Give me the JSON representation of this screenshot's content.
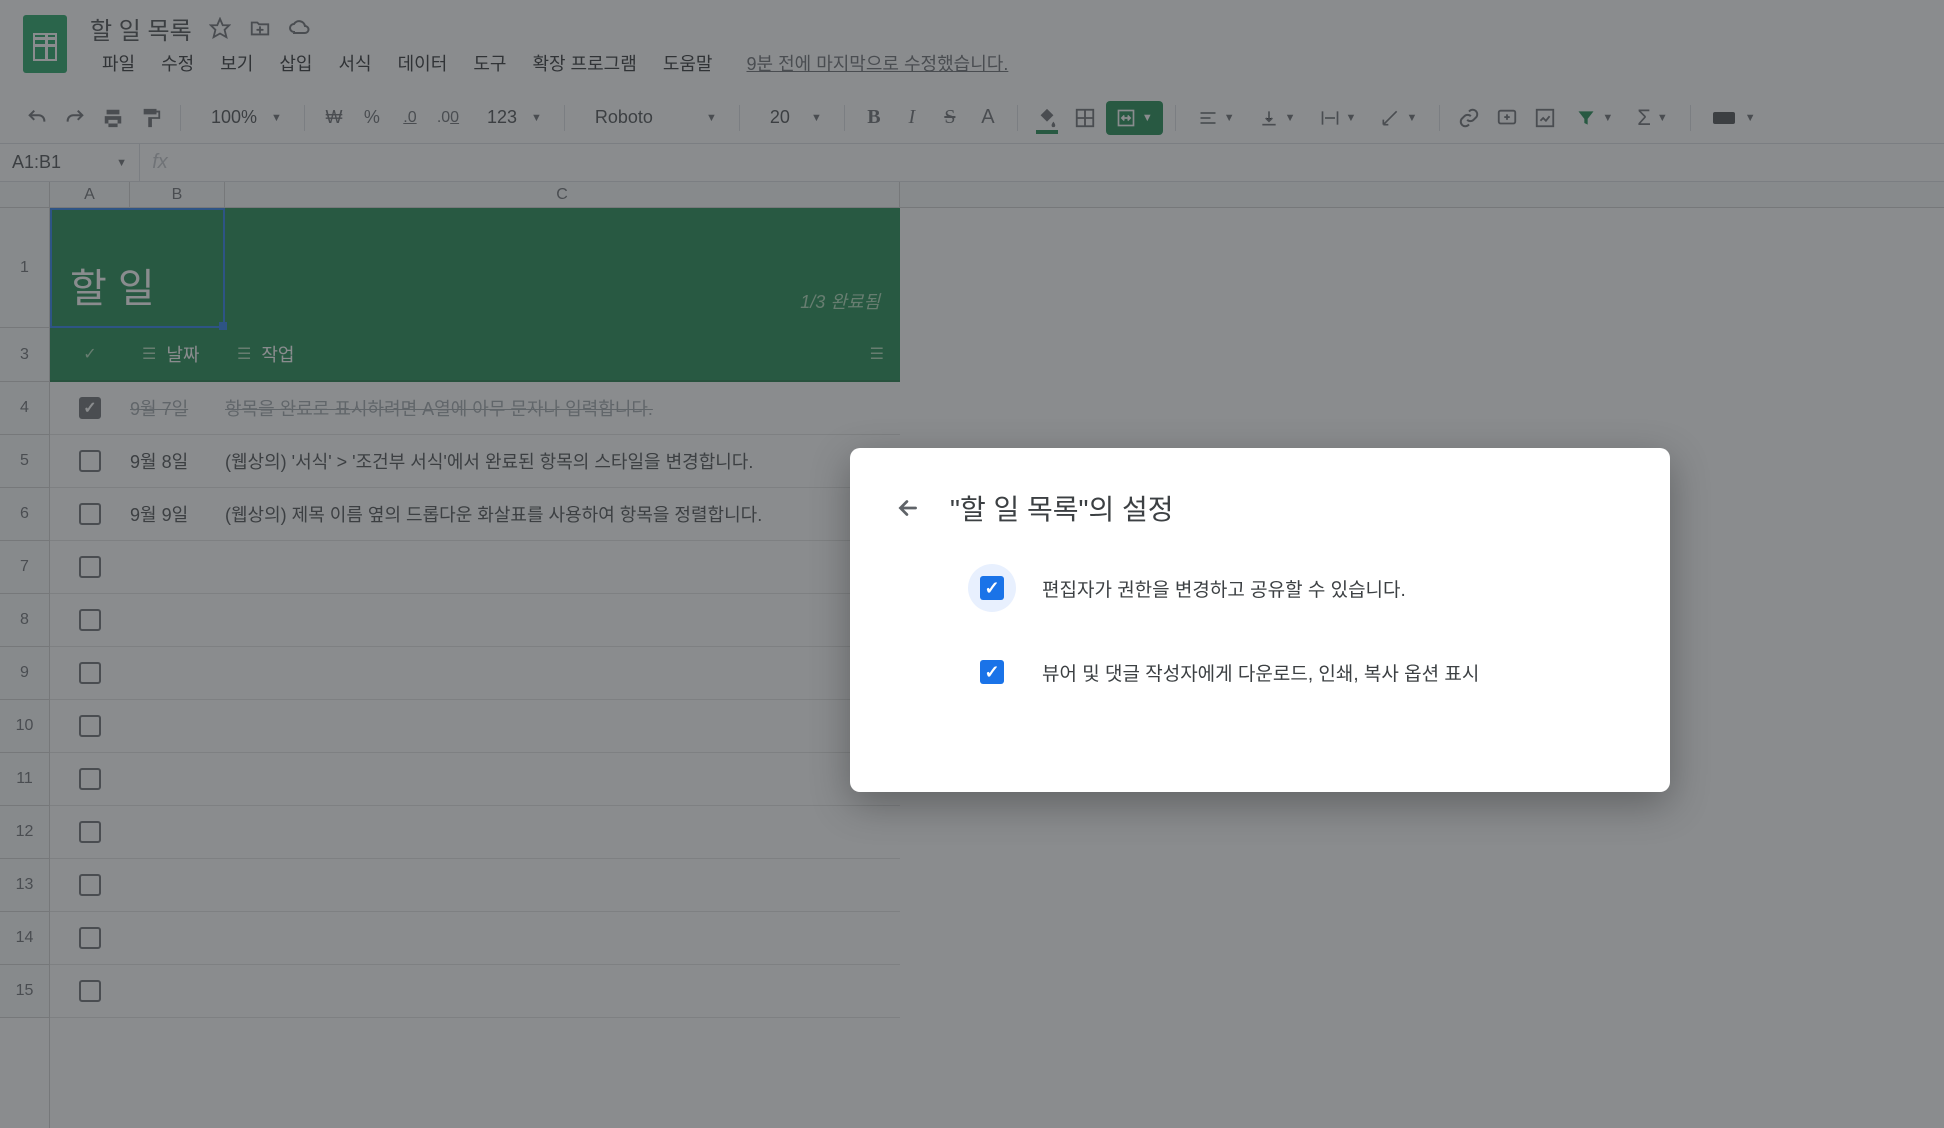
{
  "header": {
    "doc_title": "할 일 목록",
    "menus": [
      "파일",
      "수정",
      "보기",
      "삽입",
      "서식",
      "데이터",
      "도구",
      "확장 프로그램",
      "도움말"
    ],
    "last_edit": "9분 전에 마지막으로 수정했습니다."
  },
  "toolbar": {
    "zoom": "100%",
    "currency": "₩",
    "percent": "%",
    "dec_dec": ".0",
    "dec_inc": ".00",
    "numfmt": "123",
    "font": "Roboto",
    "size": "20"
  },
  "namebox": {
    "ref": "A1:B1",
    "fx": "fx"
  },
  "columns": [
    "A",
    "B",
    "C"
  ],
  "banner": {
    "title": "할 일",
    "sub": "1/3 완료됨"
  },
  "headers": {
    "date": "날짜",
    "task": "작업"
  },
  "rows": [
    {
      "checked": true,
      "date": "9월 7일",
      "task": "항목을 완료로 표시하려면 A열에 아무 문자나 입력합니다."
    },
    {
      "checked": false,
      "date": "9월 8일",
      "task": "(웹상의) '서식' > '조건부 서식'에서 완료된 항목의 스타일을 변경합니다."
    },
    {
      "checked": false,
      "date": "9월 9일",
      "task": "(웹상의) 제목 이름 옆의 드롭다운 화살표를 사용하여 항목을 정렬합니다."
    }
  ],
  "dialog": {
    "title": "\"할 일 목록\"의 설정",
    "opt1": "편집자가 권한을 변경하고 공유할 수 있습니다.",
    "opt2": "뷰어 및 댓글 작성자에게 다운로드, 인쇄, 복사 옵션 표시"
  }
}
